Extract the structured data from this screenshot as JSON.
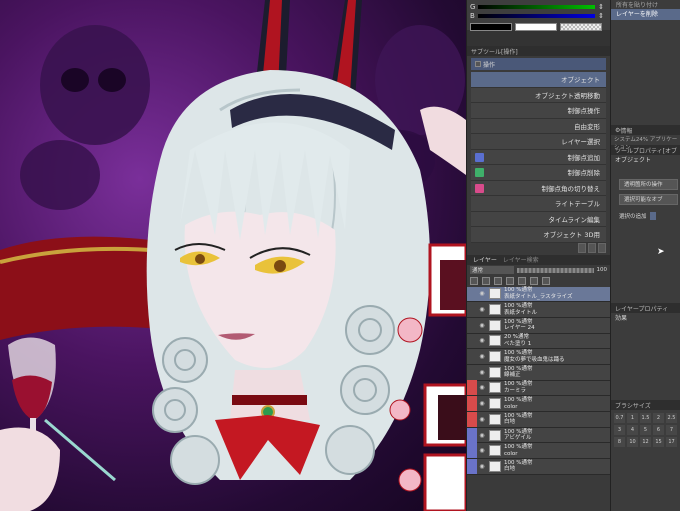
{
  "color_slider": {
    "g_label": "G",
    "b_label": "B"
  },
  "tool_panel": {
    "tab_label": "サブツール[操作]",
    "header_label": "操作",
    "items": [
      {
        "label": "オブジェクト",
        "active": true
      },
      {
        "label": "オブジェクト透明移動",
        "active": false
      },
      {
        "label": "制御点操作",
        "active": false
      },
      {
        "label": "自由変形",
        "active": false
      },
      {
        "label": "レイヤー選択",
        "active": false
      },
      {
        "label": "制御点追加",
        "active": false
      },
      {
        "label": "制御点削除",
        "active": false
      },
      {
        "label": "制御点角の切り替え",
        "active": false
      },
      {
        "label": "ライトテーブル",
        "active": false
      },
      {
        "label": "タイムライン編集",
        "active": false
      },
      {
        "label": "オブジェクト 3D用",
        "active": false
      }
    ]
  },
  "layer_panel": {
    "tabs": [
      "レイヤー",
      "レイヤー検索"
    ],
    "blend_mode": "通常",
    "opacity": "100",
    "layers": [
      {
        "line1": "100 %通常",
        "line2": "表紙タイトル_ラスタライズ",
        "selected": true,
        "mark": ""
      },
      {
        "line1": "100 %通常",
        "line2": "表紙タイトル",
        "selected": false,
        "mark": ""
      },
      {
        "line1": "100 %通常",
        "line2": "レイヤー 24",
        "selected": false,
        "mark": ""
      },
      {
        "line1": "20 %通常",
        "line2": "べた塗り 1",
        "selected": false,
        "mark": ""
      },
      {
        "line1": "100 %通常",
        "line2": "魔女の夢で吸血鬼は踊る",
        "selected": false,
        "mark": ""
      },
      {
        "line1": "100 %通常",
        "line2": "線補正",
        "selected": false,
        "mark": ""
      },
      {
        "line1": "100 %通常",
        "line2": "カーミラ",
        "selected": false,
        "mark": "red"
      },
      {
        "line1": "100 %通常",
        "line2": "color",
        "selected": false,
        "mark": "red"
      },
      {
        "line1": "100 %通常",
        "line2": "白地",
        "selected": false,
        "mark": "red"
      },
      {
        "line1": "100 %通常",
        "line2": "アビゲイル",
        "selected": false,
        "mark": "blue"
      },
      {
        "line1": "100 %通常",
        "line2": "color",
        "selected": false,
        "mark": "blue"
      },
      {
        "line1": "100 %通常",
        "line2": "白地",
        "selected": false,
        "mark": "blue"
      }
    ]
  },
  "right_panel": {
    "top_item1": "所有を貼り付け",
    "top_item2": "レイヤーを削除",
    "info_label": "情報",
    "system_label": "システム24% アプリケーション",
    "tool_property_tab": "ツールプロパティ[オブ",
    "object_label": "オブジェクト",
    "btn1": "透明箇所の操作",
    "btn2": "選択可能なオブ",
    "add_selection": "選択の追加",
    "layer_property_tab": "レイヤープロパティ",
    "effect_label": "効果",
    "brush_size_tab": "ブラシサイズ",
    "size_values": [
      "0.7",
      "1",
      "1.5",
      "2",
      "2.5",
      "3",
      "4",
      "5",
      "6",
      "7",
      "8",
      "10",
      "12",
      "15",
      "17"
    ]
  },
  "colors": {
    "accent": "#5a6a8a",
    "red_mark": "#d84b4b",
    "blue_mark": "#6a73c9"
  }
}
